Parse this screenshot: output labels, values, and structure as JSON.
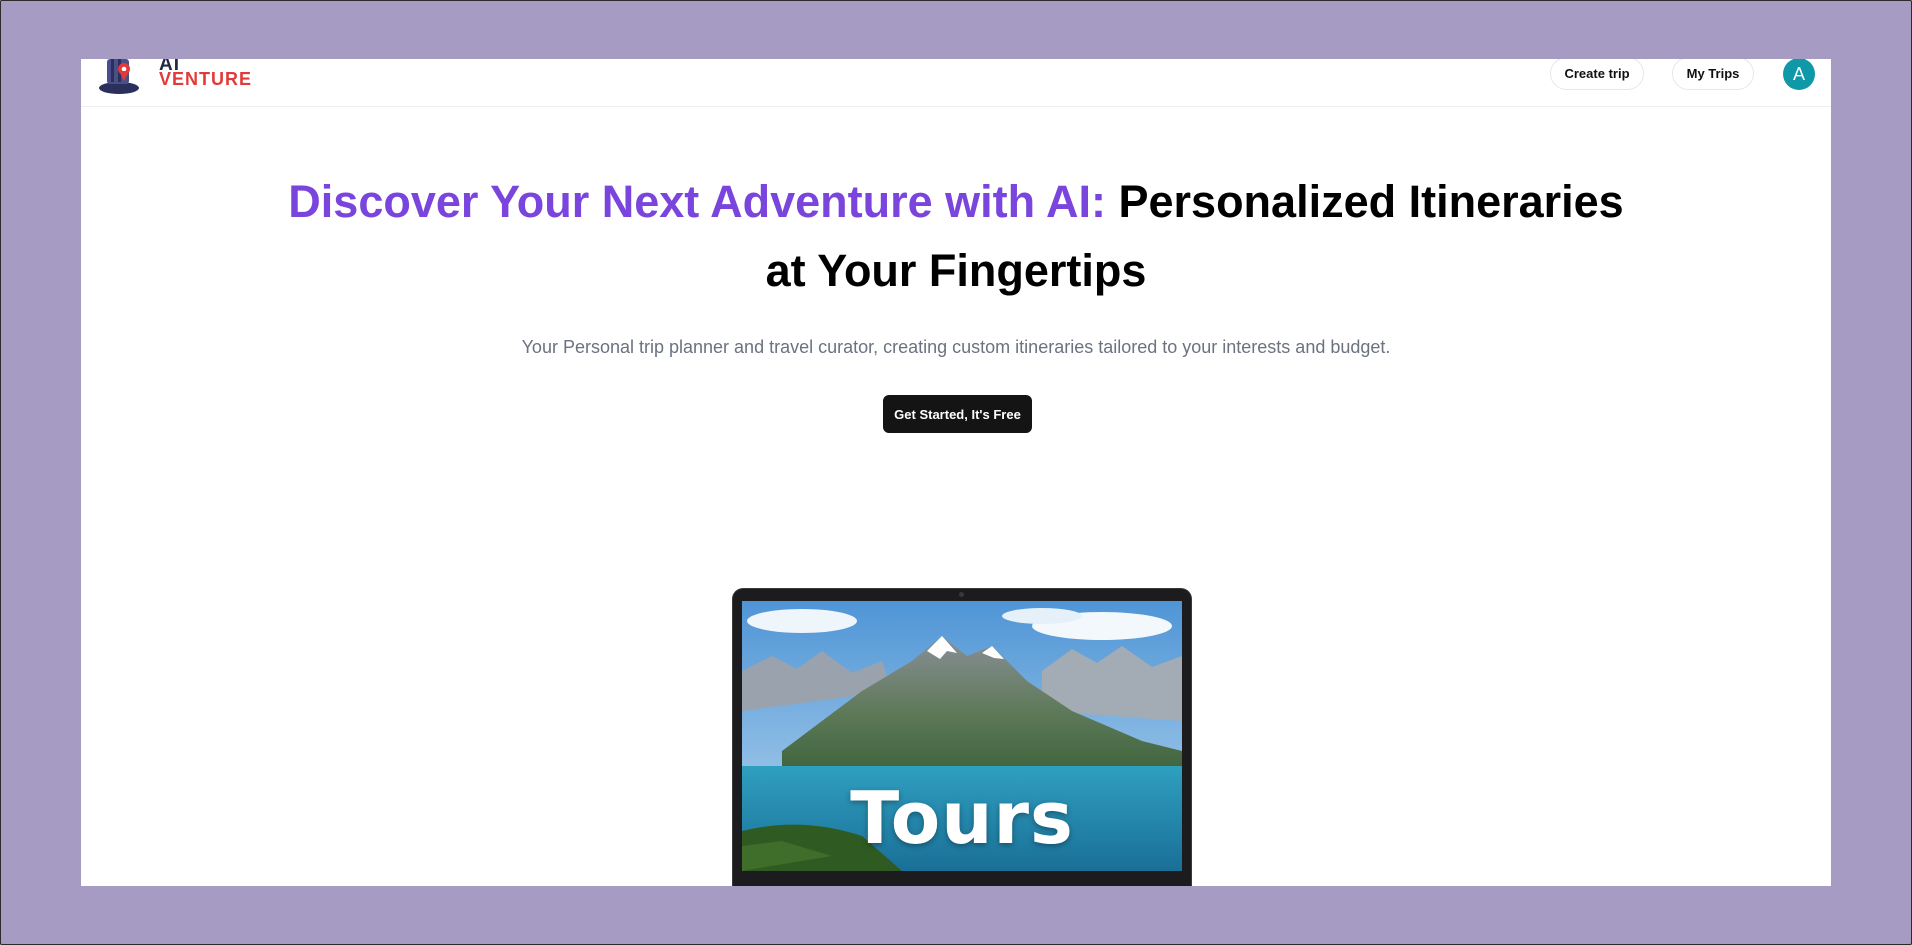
{
  "header": {
    "logo": {
      "line1": "AI",
      "line2": "VENTURE"
    },
    "create_trip_label": "Create trip",
    "my_trips_label": "My Trips",
    "avatar_initial": "A"
  },
  "hero": {
    "title_accent": "Discover Your Next Adventure with AI:",
    "title_rest": "Personalized Itineraries at Your Fingertips",
    "subtitle": "Your Personal trip planner and travel curator, creating custom itineraries tailored to your interests and budget.",
    "cta_label": "Get Started, It's Free"
  },
  "showcase": {
    "screen_word": "Tours"
  },
  "colors": {
    "background": "#a69bc2",
    "accent": "#7a45dd",
    "avatar": "#0e98a8",
    "cta": "#141414",
    "logo_red": "#e23a3a"
  }
}
